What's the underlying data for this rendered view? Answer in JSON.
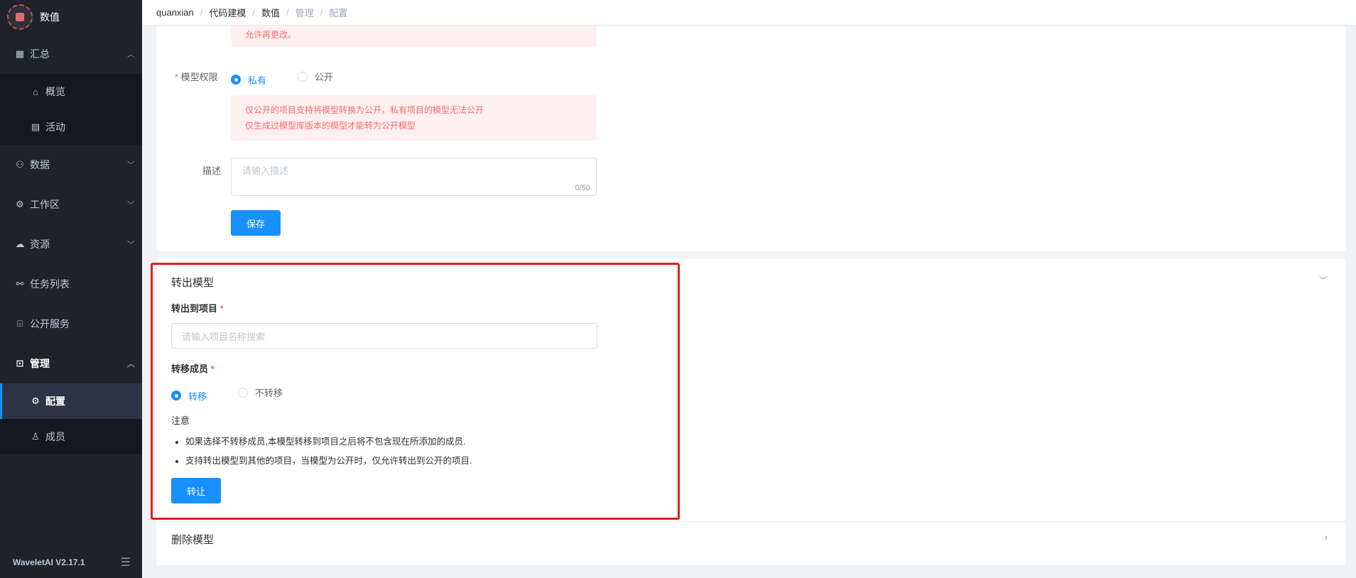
{
  "app": {
    "logo_text": "数值",
    "version": "WaveletAI V2.17.1"
  },
  "sidebar": {
    "items": [
      {
        "label": "汇总",
        "icon": "grid-icon",
        "expanded": true,
        "children": [
          {
            "label": "概览",
            "icon": "home-icon"
          },
          {
            "label": "活动",
            "icon": "calendar-icon"
          }
        ]
      },
      {
        "label": "数据",
        "icon": "hierarchy-icon"
      },
      {
        "label": "工作区",
        "icon": "gear-icon"
      },
      {
        "label": "资源",
        "icon": "cloud-icon"
      },
      {
        "label": "任务列表",
        "icon": "tasks-icon"
      },
      {
        "label": "公开服务",
        "icon": "store-icon"
      },
      {
        "label": "管理",
        "icon": "admin-icon",
        "expanded": true,
        "children": [
          {
            "label": "配置",
            "icon": "gear-icon",
            "active": true
          },
          {
            "label": "成员",
            "icon": "user-icon"
          }
        ]
      }
    ]
  },
  "breadcrumb": [
    "quanxian",
    "代码建模",
    "数值",
    "管理",
    "配置"
  ],
  "settings": {
    "notice_top": "允许再更改。",
    "permission_label": "模型权限",
    "permission_options": [
      "私有",
      "公开"
    ],
    "permission_selected": "私有",
    "permission_notice": [
      "仅公开的项目支持将模型转换为公开，私有项目的模型无法公开",
      "仅生成过模型库版本的模型才能转为公开模型"
    ],
    "description_label": "描述",
    "description_placeholder": "请输入描述",
    "description_counter": "0/50",
    "save_label": "保存"
  },
  "transfer": {
    "title": "转出模型",
    "target_label": "转出到项目",
    "target_placeholder": "请输入项目名称搜索",
    "members_label": "转移成员",
    "members_options": [
      "转移",
      "不转移"
    ],
    "members_selected": "转移",
    "note_title": "注意",
    "notes": [
      "如果选择不转移成员,本模型转移到项目之后将不包含现在所添加的成员.",
      "支持转出模型到其他的项目，当模型为公开时，仅允许转出到公开的项目."
    ],
    "submit_label": "转让"
  },
  "delete": {
    "title": "删除模型"
  },
  "colors": {
    "primary": "#1890ff",
    "sidebar_bg": "#1f2229",
    "warning_bg": "#fef0f0",
    "warning_text": "#f56c6c",
    "highlight": "#e0201e"
  }
}
